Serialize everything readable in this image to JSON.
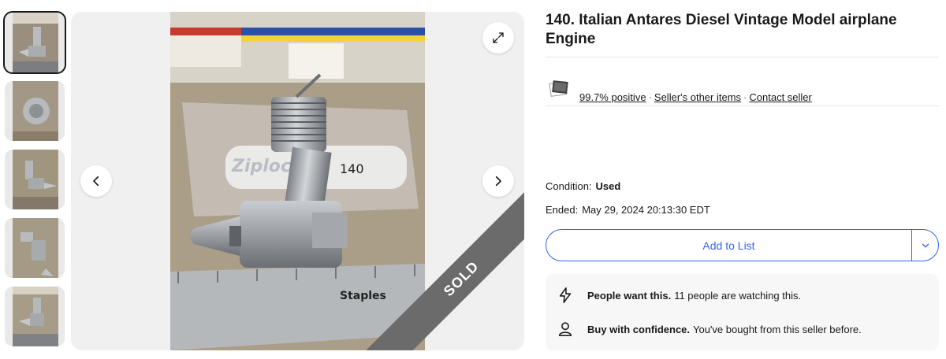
{
  "listing": {
    "title": "140. Italian Antares Diesel Vintage Model airplane Engine",
    "image_badge": "SOLD",
    "thumbnail_count": 5
  },
  "seller": {
    "feedback": "99.7% positive",
    "other_items": "Seller's other items",
    "contact": "Contact seller",
    "separator": "·"
  },
  "details": {
    "condition_label": "Condition:",
    "condition_value": "Used",
    "ended_label": "Ended:",
    "ended_value": "May 29, 2024 20:13:30 EDT"
  },
  "actions": {
    "add_to_list": "Add to List"
  },
  "promo": {
    "watching_title": "People want this.",
    "watching_text": "11 people are watching this.",
    "confidence_title": "Buy with confidence.",
    "confidence_text": "You've bought from this seller before."
  },
  "icons": {
    "expand": "expand-icon",
    "prev": "chevron-left-icon",
    "next": "chevron-right-icon",
    "dropdown": "chevron-down-icon",
    "bolt": "lightning-icon",
    "person": "person-icon",
    "seller": "store-icon"
  },
  "colors": {
    "accent": "#3665f3",
    "sold_band": "#6b6b6b",
    "promo_bg": "#f7f7f7"
  }
}
